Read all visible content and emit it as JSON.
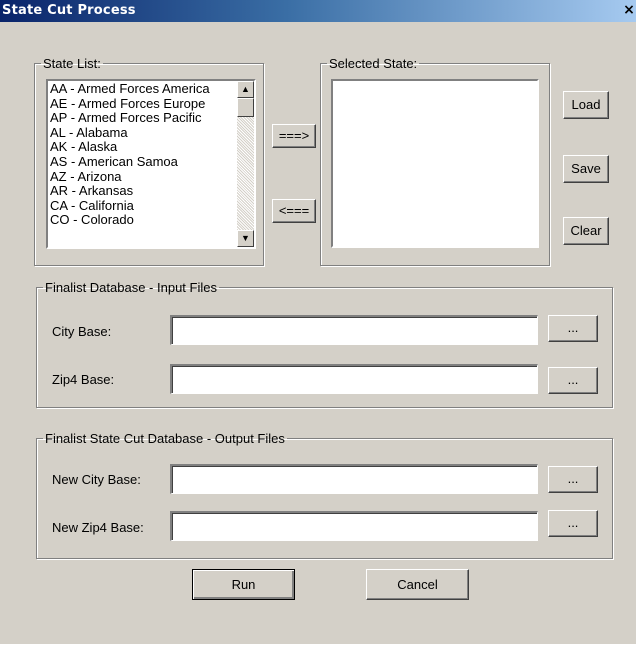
{
  "window": {
    "title": "State Cut Process",
    "close_glyph": "×"
  },
  "state_list": {
    "legend": "State List:",
    "items": [
      "AA - Armed Forces America",
      "AE - Armed Forces Europe",
      "AP - Armed Forces Pacific",
      "AL - Alabama",
      "AK - Alaska",
      "AS - American Samoa",
      "AZ - Arizona",
      "AR - Arkansas",
      "CA - California",
      "CO - Colorado"
    ],
    "scroll_up_icon": "▲",
    "scroll_down_icon": "▼"
  },
  "transfer": {
    "add_label": "===>",
    "remove_label": "<==="
  },
  "selected_state": {
    "legend": "Selected State:",
    "items": []
  },
  "side_buttons": {
    "load": "Load",
    "save": "Save",
    "clear": "Clear"
  },
  "input_files": {
    "legend": "Finalist Database - Input Files",
    "city_label": "City Base:",
    "city_value": "",
    "zip4_label": "Zip4 Base:",
    "zip4_value": "",
    "browse_label": "..."
  },
  "output_files": {
    "legend": "Finalist State Cut Database - Output Files",
    "new_city_label": "New City Base:",
    "new_city_value": "",
    "new_zip4_label": "New Zip4 Base:",
    "new_zip4_value": "",
    "browse_label": "..."
  },
  "actions": {
    "run": "Run",
    "cancel": "Cancel"
  }
}
